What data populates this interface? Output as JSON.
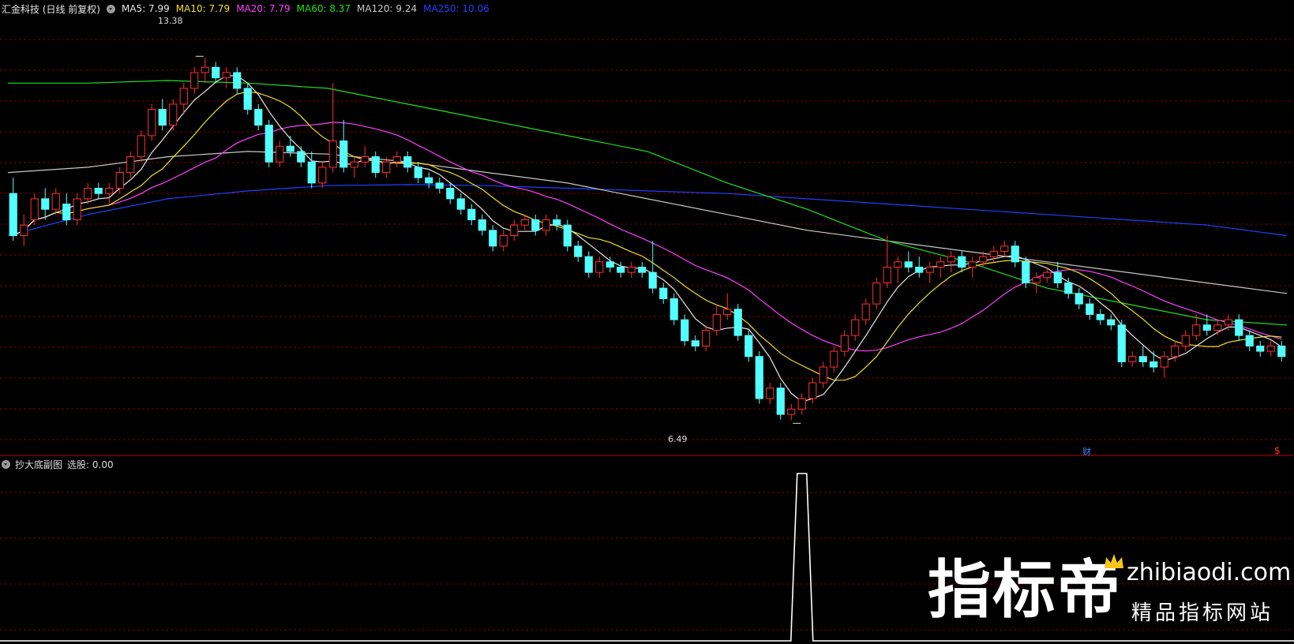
{
  "header": {
    "ticker": "汇金科技 (日线 前复权)",
    "ma_items": [
      {
        "label": "MA5: 7.99",
        "color": "#e6e6e6"
      },
      {
        "label": "MA10: 7.79",
        "color": "#f0e020"
      },
      {
        "label": "MA20: 7.79",
        "color": "#ff40ff"
      },
      {
        "label": "MA60: 8.37",
        "color": "#20e020"
      },
      {
        "label": "MA120: 9.24",
        "color": "#c8c8c8"
      },
      {
        "label": "MA250: 10.06",
        "color": "#2040ff"
      }
    ]
  },
  "annotations": {
    "high_label": "13.38",
    "low_label": "6.49",
    "fin_badge": "财",
    "dollar_badge": "$"
  },
  "sub_panel": {
    "title": "抄大底副图",
    "value_label": "选股: 0.00"
  },
  "watermark": {
    "brand": "指标帝",
    "domain": "zhibiaodi.com",
    "tagline": "精品指标网站"
  },
  "colors": {
    "up": "#ff3030",
    "down": "#54ffff",
    "grid": "#7a0000",
    "divider": "#c00000"
  },
  "chart_data": [
    {
      "type": "candlestick",
      "title": "汇金科技 (日线 前复权)",
      "ylim": [
        6.0,
        14.0
      ],
      "candles": [
        [
          10.8,
          11.1,
          9.9,
          10.0
        ],
        [
          10.0,
          10.4,
          9.8,
          10.2
        ],
        [
          10.3,
          10.8,
          10.2,
          10.7
        ],
        [
          10.7,
          10.9,
          10.3,
          10.5
        ],
        [
          10.5,
          10.9,
          10.4,
          10.8
        ],
        [
          10.6,
          10.8,
          10.2,
          10.3
        ],
        [
          10.3,
          10.8,
          10.2,
          10.7
        ],
        [
          10.7,
          11.0,
          10.6,
          10.9
        ],
        [
          10.9,
          11.0,
          10.7,
          10.8
        ],
        [
          10.8,
          11.0,
          10.6,
          10.9
        ],
        [
          10.9,
          11.3,
          10.8,
          11.2
        ],
        [
          11.2,
          11.6,
          11.1,
          11.5
        ],
        [
          11.5,
          12.0,
          11.4,
          11.9
        ],
        [
          11.9,
          12.5,
          11.8,
          12.4
        ],
        [
          12.4,
          12.6,
          12.0,
          12.1
        ],
        [
          12.1,
          12.6,
          12.0,
          12.5
        ],
        [
          12.5,
          12.9,
          12.3,
          12.8
        ],
        [
          12.8,
          13.2,
          12.7,
          13.1
        ],
        [
          13.1,
          13.38,
          12.9,
          13.2
        ],
        [
          13.2,
          13.3,
          12.9,
          13.0
        ],
        [
          13.0,
          13.2,
          12.8,
          13.1
        ],
        [
          13.1,
          13.2,
          12.7,
          12.8
        ],
        [
          12.8,
          12.9,
          12.3,
          12.4
        ],
        [
          12.4,
          12.5,
          12.0,
          12.1
        ],
        [
          12.1,
          12.2,
          11.3,
          11.4
        ],
        [
          11.4,
          11.8,
          11.3,
          11.7
        ],
        [
          11.7,
          11.9,
          11.5,
          11.6
        ],
        [
          11.6,
          11.7,
          11.3,
          11.4
        ],
        [
          11.4,
          11.6,
          10.9,
          11.0
        ],
        [
          11.0,
          11.4,
          10.9,
          11.3
        ],
        [
          11.3,
          12.9,
          11.2,
          11.8
        ],
        [
          11.8,
          12.2,
          11.2,
          11.3
        ],
        [
          11.3,
          11.5,
          11.1,
          11.4
        ],
        [
          11.4,
          11.7,
          11.3,
          11.5
        ],
        [
          11.5,
          11.6,
          11.1,
          11.2
        ],
        [
          11.2,
          11.5,
          11.1,
          11.4
        ],
        [
          11.4,
          11.6,
          11.3,
          11.5
        ],
        [
          11.5,
          11.6,
          11.2,
          11.3
        ],
        [
          11.3,
          11.4,
          11.0,
          11.1
        ],
        [
          11.1,
          11.2,
          10.9,
          11.0
        ],
        [
          11.0,
          11.1,
          10.8,
          10.9
        ],
        [
          10.9,
          11.0,
          10.6,
          10.7
        ],
        [
          10.7,
          10.8,
          10.4,
          10.5
        ],
        [
          10.5,
          10.6,
          10.2,
          10.3
        ],
        [
          10.3,
          10.4,
          10.0,
          10.1
        ],
        [
          10.1,
          10.2,
          9.7,
          9.8
        ],
        [
          9.8,
          10.1,
          9.7,
          10.0
        ],
        [
          10.0,
          10.3,
          9.9,
          10.2
        ],
        [
          10.2,
          10.4,
          10.1,
          10.3
        ],
        [
          10.3,
          10.4,
          10.0,
          10.1
        ],
        [
          10.1,
          10.4,
          10.0,
          10.3
        ],
        [
          10.3,
          10.4,
          10.1,
          10.2
        ],
        [
          10.2,
          10.3,
          9.7,
          9.8
        ],
        [
          9.8,
          9.9,
          9.5,
          9.6
        ],
        [
          9.6,
          9.7,
          9.2,
          9.3
        ],
        [
          9.3,
          9.6,
          9.2,
          9.5
        ],
        [
          9.5,
          9.6,
          9.3,
          9.4
        ],
        [
          9.4,
          9.5,
          9.2,
          9.3
        ],
        [
          9.3,
          9.5,
          9.2,
          9.4
        ],
        [
          9.4,
          9.5,
          9.2,
          9.3
        ],
        [
          9.3,
          9.9,
          8.9,
          9.0
        ],
        [
          9.0,
          9.1,
          8.7,
          8.8
        ],
        [
          8.8,
          8.9,
          8.3,
          8.4
        ],
        [
          8.4,
          8.5,
          7.9,
          8.0
        ],
        [
          8.0,
          8.1,
          7.8,
          7.9
        ],
        [
          7.9,
          8.3,
          7.8,
          8.2
        ],
        [
          8.2,
          8.7,
          8.1,
          8.5
        ],
        [
          8.5,
          8.9,
          8.4,
          8.6
        ],
        [
          8.6,
          8.7,
          8.0,
          8.1
        ],
        [
          8.1,
          8.2,
          7.6,
          7.7
        ],
        [
          7.7,
          7.8,
          6.8,
          6.9
        ],
        [
          6.9,
          7.2,
          6.8,
          7.1
        ],
        [
          7.1,
          7.2,
          6.5,
          6.6
        ],
        [
          6.6,
          6.8,
          6.49,
          6.7
        ],
        [
          6.7,
          7.0,
          6.6,
          6.9
        ],
        [
          6.9,
          7.3,
          6.8,
          7.2
        ],
        [
          7.2,
          7.6,
          7.1,
          7.5
        ],
        [
          7.5,
          7.9,
          7.4,
          7.8
        ],
        [
          7.8,
          8.2,
          7.7,
          8.1
        ],
        [
          8.1,
          8.5,
          8.0,
          8.4
        ],
        [
          8.4,
          8.8,
          8.3,
          8.7
        ],
        [
          8.7,
          9.2,
          8.6,
          9.1
        ],
        [
          9.1,
          10.0,
          9.0,
          9.4
        ],
        [
          9.4,
          9.6,
          9.1,
          9.5
        ],
        [
          9.5,
          9.7,
          9.3,
          9.4
        ],
        [
          9.4,
          9.6,
          9.2,
          9.3
        ],
        [
          9.3,
          9.5,
          9.1,
          9.4
        ],
        [
          9.4,
          9.6,
          9.2,
          9.5
        ],
        [
          9.5,
          9.7,
          9.3,
          9.6
        ],
        [
          9.6,
          9.7,
          9.3,
          9.4
        ],
        [
          9.4,
          9.6,
          9.2,
          9.5
        ],
        [
          9.5,
          9.7,
          9.4,
          9.6
        ],
        [
          9.6,
          9.8,
          9.5,
          9.7
        ],
        [
          9.7,
          9.9,
          9.6,
          9.8
        ],
        [
          9.8,
          9.9,
          9.4,
          9.5
        ],
        [
          9.5,
          9.6,
          9.0,
          9.1
        ],
        [
          9.1,
          9.3,
          8.9,
          9.2
        ],
        [
          9.2,
          9.4,
          9.1,
          9.3
        ],
        [
          9.3,
          9.5,
          9.0,
          9.1
        ],
        [
          9.1,
          9.2,
          8.8,
          8.9
        ],
        [
          8.9,
          9.0,
          8.6,
          8.7
        ],
        [
          8.7,
          8.8,
          8.4,
          8.5
        ],
        [
          8.5,
          8.6,
          8.3,
          8.4
        ],
        [
          8.4,
          8.5,
          8.2,
          8.3
        ],
        [
          8.3,
          8.4,
          7.5,
          7.6
        ],
        [
          7.6,
          7.8,
          7.5,
          7.7
        ],
        [
          7.7,
          7.9,
          7.5,
          7.6
        ],
        [
          7.6,
          7.8,
          7.4,
          7.5
        ],
        [
          7.5,
          7.8,
          7.3,
          7.7
        ],
        [
          7.7,
          8.0,
          7.6,
          7.9
        ],
        [
          7.9,
          8.2,
          7.8,
          8.1
        ],
        [
          8.1,
          8.5,
          8.0,
          8.3
        ],
        [
          8.3,
          8.5,
          8.1,
          8.2
        ],
        [
          8.2,
          8.4,
          8.1,
          8.3
        ],
        [
          8.3,
          8.5,
          8.2,
          8.4
        ],
        [
          8.4,
          8.5,
          8.0,
          8.1
        ],
        [
          8.1,
          8.2,
          7.8,
          7.9
        ],
        [
          7.9,
          8.0,
          7.7,
          7.8
        ],
        [
          7.8,
          8.0,
          7.7,
          7.9
        ],
        [
          7.9,
          8.0,
          7.6,
          7.7
        ]
      ],
      "ma": {
        "MA5": {
          "color": "#e6e6e6"
        },
        "MA10": {
          "color": "#f0e020"
        },
        "MA20": {
          "color": "#ff40ff"
        },
        "MA60": {
          "color": "#20e020"
        },
        "MA120": {
          "color": "#c8c8c8"
        },
        "MA250": {
          "color": "#2040ff"
        }
      },
      "long_ma": {
        "MA60": [
          12.9,
          12.9,
          12.95,
          12.9,
          12.8,
          12.5,
          12.2,
          11.9,
          11.6,
          11.0,
          10.5,
          9.9,
          9.5,
          9.0,
          8.7,
          8.4,
          8.3
        ],
        "MA120": [
          11.2,
          11.3,
          11.5,
          11.6,
          11.55,
          11.4,
          11.2,
          11.0,
          10.7,
          10.4,
          10.1,
          9.9,
          9.7,
          9.5,
          9.3,
          9.1,
          8.9
        ],
        "MA250": [
          10.0,
          10.4,
          10.7,
          10.85,
          10.95,
          10.97,
          10.95,
          10.9,
          10.85,
          10.8,
          10.7,
          10.6,
          10.5,
          10.4,
          10.3,
          10.2,
          10.0
        ]
      }
    },
    {
      "type": "line",
      "title": "抄大底副图",
      "ylim": [
        0,
        1
      ],
      "signal": {
        "index": 74,
        "value": 1
      }
    }
  ]
}
